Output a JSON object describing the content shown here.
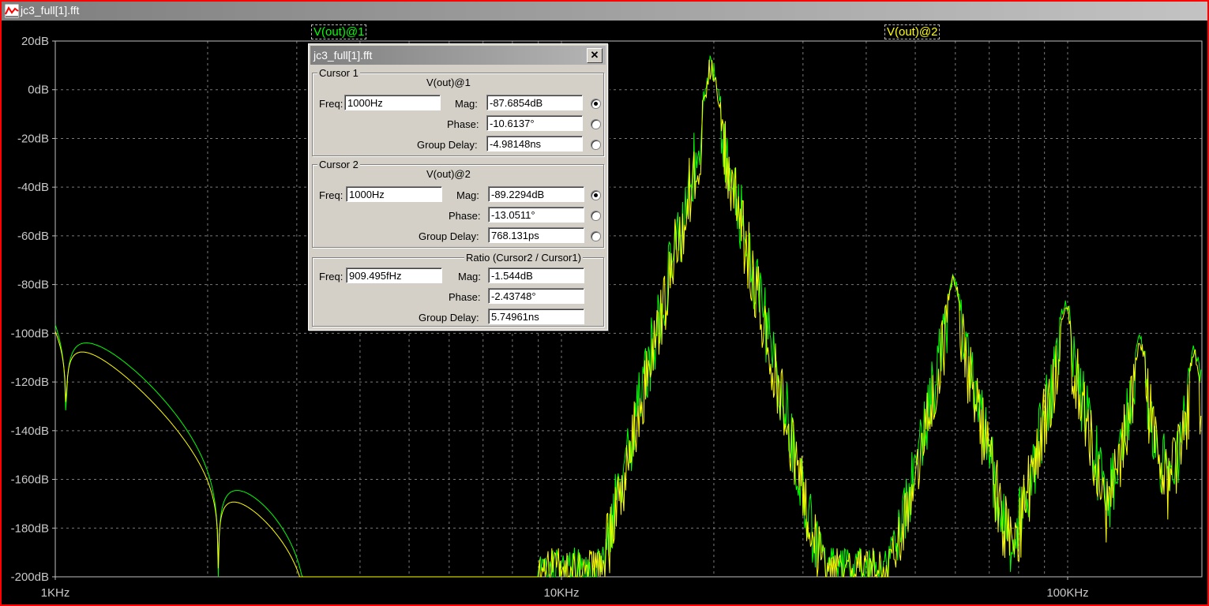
{
  "window": {
    "title": "jc3_full[1].fft"
  },
  "plot": {
    "traces": [
      {
        "label": "V(out)@1",
        "color": "#00ff00"
      },
      {
        "label": "V(out)@2",
        "color": "#ffff00"
      }
    ],
    "y_ticks": [
      "20dB",
      "0dB",
      "-20dB",
      "-40dB",
      "-60dB",
      "-80dB",
      "-100dB",
      "-120dB",
      "-140dB",
      "-160dB",
      "-180dB",
      "-200dB"
    ],
    "x_ticks": [
      "1KHz",
      "10KHz",
      "100KHz"
    ]
  },
  "chart_data": {
    "type": "line",
    "x_scale": "log",
    "xlim": [
      "1KHz",
      "~250KHz"
    ],
    "ylim": [
      -200,
      20
    ],
    "grid": true,
    "series": [
      {
        "name": "V(out)@1",
        "color": "#00ff00"
      },
      {
        "name": "V(out)@2",
        "color": "#ffff00"
      }
    ]
  },
  "dialog": {
    "title": "jc3_full[1].fft",
    "close": "✕",
    "cursor1": {
      "title": "Cursor 1",
      "trace": "V(out)@1",
      "freq_label": "Freq:",
      "freq": "1000Hz",
      "mag_label": "Mag:",
      "mag": "-87.6854dB",
      "phase_label": "Phase:",
      "phase": "-10.6137°",
      "gd_label": "Group Delay:",
      "gd": "-4.98148ns"
    },
    "cursor2": {
      "title": "Cursor 2",
      "trace": "V(out)@2",
      "freq_label": "Freq:",
      "freq": "1000Hz",
      "mag_label": "Mag:",
      "mag": "-89.2294dB",
      "phase_label": "Phase:",
      "phase": "-13.0511°",
      "gd_label": "Group Delay:",
      "gd": "768.131ps"
    },
    "ratio": {
      "title": "Ratio (Cursor2 / Cursor1)",
      "freq_label": "Freq:",
      "freq": "909.495fHz",
      "mag_label": "Mag:",
      "mag": "-1.544dB",
      "phase_label": "Phase:",
      "phase": "-2.43748°",
      "gd_label": "Group Delay:",
      "gd": "5.74961ns"
    }
  }
}
